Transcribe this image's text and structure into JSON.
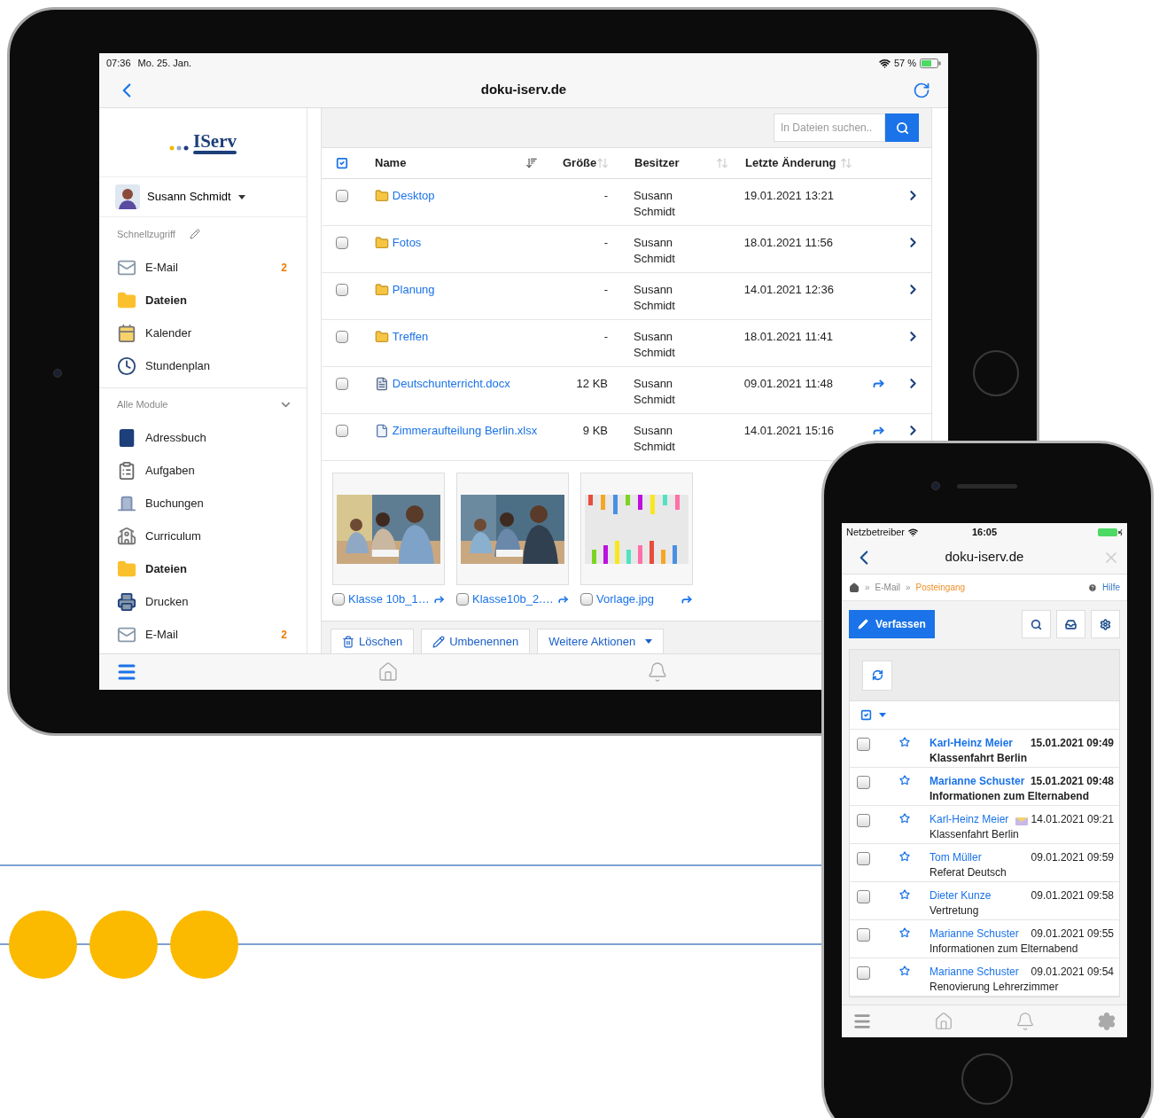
{
  "tablet": {
    "status_bar": {
      "time": "07:36",
      "date": "Mo. 25. Jan.",
      "battery": "57 %"
    },
    "nav": {
      "title": "doku-iserv.de"
    },
    "sidebar": {
      "logo": "IServ",
      "user": "Susann Schmidt",
      "quick_access": {
        "label": "Schnellzugriff",
        "items": [
          {
            "label": "E-Mail",
            "badge": "2",
            "selected": false
          },
          {
            "label": "Dateien",
            "selected": true
          },
          {
            "label": "Kalender",
            "selected": false
          },
          {
            "label": "Stundenplan",
            "selected": false
          }
        ]
      },
      "modules": {
        "label": "Alle Module",
        "expanded": true,
        "items": [
          {
            "label": "Adressbuch",
            "selected": false
          },
          {
            "label": "Aufgaben",
            "selected": false
          },
          {
            "label": "Buchungen",
            "selected": false
          },
          {
            "label": "Curriculum",
            "selected": false
          },
          {
            "label": "Dateien",
            "selected": true
          },
          {
            "label": "Drucken",
            "selected": false
          },
          {
            "label": "E-Mail",
            "badge": "2",
            "selected": false
          }
        ]
      }
    },
    "search": {
      "placeholder": "In Dateien suchen.."
    },
    "table": {
      "columns": [
        {
          "label": "Name",
          "sorted": true
        },
        {
          "label": "Größe",
          "sorted": false
        },
        {
          "label": "Besitzer",
          "sorted": false
        },
        {
          "label": "Letzte Änderung",
          "sorted": false
        }
      ],
      "rows": [
        {
          "kind": "folder",
          "name": "Desktop",
          "size": "-",
          "owner": "Susann Schmidt",
          "modified": "19.01.2021 13:21",
          "shared": false,
          "checked": false
        },
        {
          "kind": "folder",
          "name": "Fotos",
          "size": "-",
          "owner": "Susann Schmidt",
          "modified": "18.01.2021 11:56",
          "shared": false,
          "checked": false
        },
        {
          "kind": "folder",
          "name": "Planung",
          "size": "-",
          "owner": "Susann Schmidt",
          "modified": "14.01.2021 12:36",
          "shared": false,
          "checked": false
        },
        {
          "kind": "folder",
          "name": "Treffen",
          "size": "-",
          "owner": "Susann Schmidt",
          "modified": "18.01.2021 11:41",
          "shared": false,
          "checked": false
        },
        {
          "kind": "document",
          "name": "Deutschunterricht.docx",
          "size": "12 KB",
          "owner": "Susann Schmidt",
          "modified": "09.01.2021 11:48",
          "shared": true,
          "checked": false
        },
        {
          "kind": "sheet",
          "name": "Zimmeraufteilung Berlin.xlsx",
          "size": "9 KB",
          "owner": "Susann Schmidt",
          "modified": "14.01.2021 15:16",
          "shared": true,
          "checked": false
        }
      ]
    },
    "thumbnails": [
      {
        "kind": "picture",
        "name": "Klasse 10b_1…",
        "shared": true,
        "checked": false
      },
      {
        "kind": "picture",
        "name": "Klasse10b_2.…",
        "shared": true,
        "checked": false
      },
      {
        "kind": "picture",
        "name": "Vorlage.jpg",
        "shared": true,
        "checked": false
      }
    ],
    "actions": [
      {
        "label": "Löschen"
      },
      {
        "label": "Umbenennen"
      },
      {
        "label": "Weitere Aktionen"
      }
    ]
  },
  "phone": {
    "status_bar": {
      "carrier": "Netzbetreiber",
      "time": "16:05"
    },
    "nav": {
      "title": "doku-iserv.de"
    },
    "breadcrumb": {
      "separator": "»",
      "items": [
        "E-Mail",
        "Posteingang"
      ]
    },
    "help": "Hilfe",
    "compose": "Verfassen",
    "mails": [
      {
        "sender": "Karl-Heinz Meier",
        "date": "15.01.2021 09:49",
        "subject": "Klassenfahrt Berlin",
        "unread": true,
        "marked": false,
        "starred": false,
        "checked": false
      },
      {
        "sender": "Marianne Schuster",
        "date": "15.01.2021 09:48",
        "subject": "Informationen zum Elternabend",
        "unread": true,
        "marked": false,
        "starred": false,
        "checked": false
      },
      {
        "sender": "Karl-Heinz Meier",
        "date": "14.01.2021 09:21",
        "subject": "Klassenfahrt Berlin",
        "unread": false,
        "marked": true,
        "starred": false,
        "checked": false
      },
      {
        "sender": "Tom Müller",
        "date": "09.01.2021 09:59",
        "subject": "Referat Deutsch",
        "unread": false,
        "marked": false,
        "starred": false,
        "checked": false
      },
      {
        "sender": "Dieter Kunze",
        "date": "09.01.2021 09:58",
        "subject": "Vertretung",
        "unread": false,
        "marked": false,
        "starred": false,
        "checked": false
      },
      {
        "sender": "Marianne Schuster",
        "date": "09.01.2021 09:55",
        "subject": "Informationen zum Elternabend",
        "unread": false,
        "marked": false,
        "starred": false,
        "checked": false
      },
      {
        "sender": "Marianne Schuster",
        "date": "09.01.2021 09:54",
        "subject": "Renovierung Lehrerzimmer",
        "unread": false,
        "marked": false,
        "starred": false,
        "checked": false
      }
    ]
  }
}
